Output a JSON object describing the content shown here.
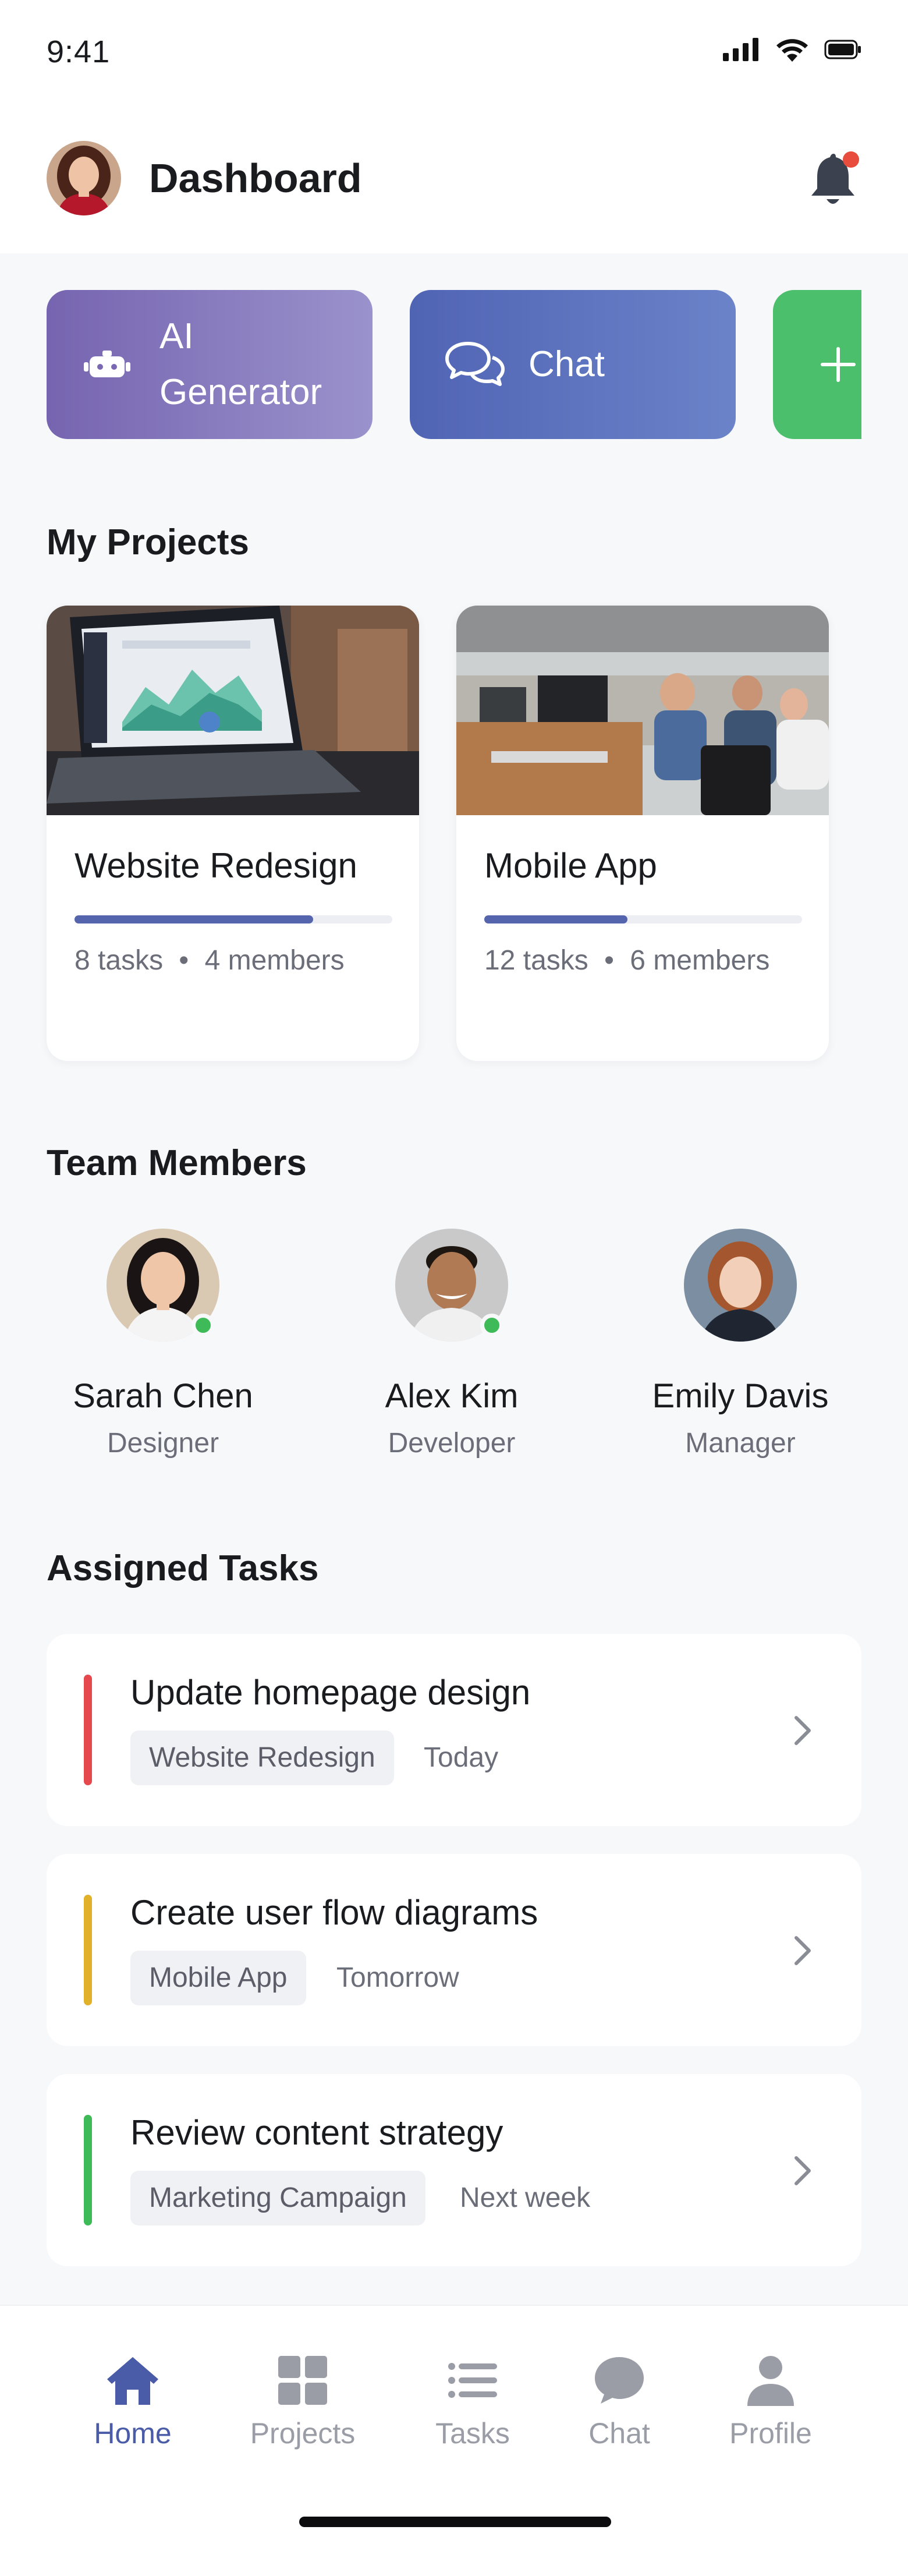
{
  "status_bar": {
    "time": "9:41",
    "icons": [
      "signal-icon",
      "wifi-icon",
      "battery-icon"
    ]
  },
  "header": {
    "title": "Dashboard",
    "notification_badge_color": "#e74c3c"
  },
  "quick_actions": [
    {
      "label_line1": "AI",
      "label_line2": "Generator",
      "icon": "robot-icon",
      "color": "#7664b0"
    },
    {
      "label": "Chat",
      "icon": "chat-bubbles-icon",
      "color": "#5064b4"
    },
    {
      "icon": "plus-icon",
      "color": "#4bbf6b"
    }
  ],
  "projects": {
    "title": "My Projects",
    "items": [
      {
        "name": "Website Redesign",
        "progress": 0.75,
        "tasks": "8 tasks",
        "members": "4 members"
      },
      {
        "name": "Mobile App",
        "progress": 0.45,
        "tasks": "12 tasks",
        "members": "6 members"
      }
    ],
    "separator": "•"
  },
  "team": {
    "title": "Team Members",
    "members": [
      {
        "name": "Sarah Chen",
        "role": "Designer",
        "online": true
      },
      {
        "name": "Alex Kim",
        "role": "Developer",
        "online": true
      },
      {
        "name": "Emily Davis",
        "role": "Manager",
        "online": false
      }
    ]
  },
  "tasks": {
    "title": "Assigned Tasks",
    "items": [
      {
        "title": "Update homepage design",
        "project": "Website Redesign",
        "due": "Today",
        "color": "#e5484d"
      },
      {
        "title": "Create user flow diagrams",
        "project": "Mobile App",
        "due": "Tomorrow",
        "color": "#e2b12a"
      },
      {
        "title": "Review content strategy",
        "project": "Marketing Campaign",
        "due": "Next week",
        "color": "#3fba58"
      }
    ]
  },
  "nav": {
    "items": [
      {
        "label": "Home",
        "icon": "home-icon",
        "active": true
      },
      {
        "label": "Projects",
        "icon": "grid-icon",
        "active": false
      },
      {
        "label": "Tasks",
        "icon": "list-icon",
        "active": false
      },
      {
        "label": "Chat",
        "icon": "chat-icon",
        "active": false
      },
      {
        "label": "Profile",
        "icon": "user-icon",
        "active": false
      }
    ],
    "active_color": "#4a5ba8",
    "inactive_color": "#9a9da6"
  }
}
